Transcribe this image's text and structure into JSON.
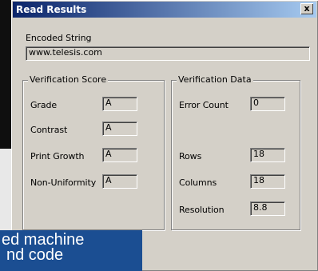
{
  "dialog": {
    "title": "Read Results",
    "close_label": "x"
  },
  "encoded": {
    "label": "Encoded String",
    "value": "www.telesis.com"
  },
  "score": {
    "legend": "Verification Score",
    "grade_label": "Grade",
    "grade_value": "A",
    "contrast_label": "Contrast",
    "contrast_value": "A",
    "print_growth_label": "Print Growth",
    "print_growth_value": "A",
    "non_uniformity_label": "Non-Uniformity",
    "non_uniformity_value": "A"
  },
  "data": {
    "legend": "Verification Data",
    "error_count_label": "Error Count",
    "error_count_value": "0",
    "rows_label": "Rows",
    "rows_value": "18",
    "columns_label": "Columns",
    "columns_value": "18",
    "resolution_label": "Resolution",
    "resolution_value": "8.8"
  },
  "banner": {
    "line1": "ed machine",
    "line2": "nd code",
    "line3": ""
  }
}
